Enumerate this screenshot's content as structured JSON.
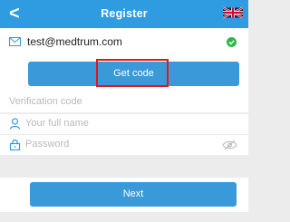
{
  "header": {
    "back_symbol": "<",
    "title": "Register",
    "flag_icon": "uk-flag-icon"
  },
  "email": {
    "value": "test@medtrum.com",
    "icon": "envelope-icon",
    "status_icon": "green-check-icon",
    "status_color": "#2db84d"
  },
  "get_code": {
    "label": "Get code",
    "highlight_color": "#e01818"
  },
  "verification": {
    "placeholder": "Verification code"
  },
  "full_name": {
    "placeholder": "Your full name",
    "icon": "person-icon"
  },
  "password": {
    "placeholder": "Password",
    "icon": "lock-icon",
    "toggle_icon": "eye-off-icon"
  },
  "next": {
    "label": "Next"
  },
  "colors": {
    "accent": "#2f9be0",
    "button": "#3a9ad9",
    "background": "#ececec"
  }
}
